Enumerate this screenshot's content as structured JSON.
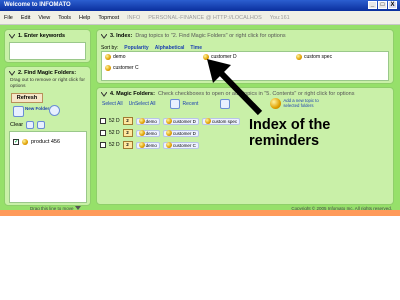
{
  "window": {
    "title": "Welcome to INFOMATO",
    "buttons": [
      "_",
      "□",
      "X"
    ]
  },
  "menu": {
    "items": [
      "File",
      "Edit",
      "View",
      "Tools",
      "Help",
      "Topmost"
    ],
    "grey_items": [
      "INFO",
      "PERSONAL-FINANCE @ HTTP://LOCALHOS",
      "You:161"
    ]
  },
  "panel1": {
    "title": "1. Enter keywords"
  },
  "panel2": {
    "title": "2. Find Magic Folders:",
    "hint": "Drag out to remove or right click for options",
    "refresh": "Refresh",
    "new_folder": "New Folder",
    "clear": "Clear",
    "folders": [
      {
        "label": "product 456",
        "checked": true
      }
    ]
  },
  "panel3": {
    "title": "3. Index:",
    "hint": "Drag topics to \"2. Find Magic Folders\" or right click for options",
    "sort_label": "Sort by:",
    "sort_options": [
      "Popularity",
      "Alphabetical",
      "Time"
    ],
    "items": [
      "demo",
      "customer D",
      "custom spec",
      "customer C"
    ]
  },
  "panel4": {
    "title": "4. Magic Folders:",
    "hint": "Check checkboxes to open or add topics in \"5. Contents\" or right click for options",
    "select_all": "Select All",
    "unselect_all": "UnSelect All",
    "recent": "Recent",
    "add_new": "Add a new topic to selected folders",
    "rows": [
      {
        "num": "52 D",
        "count": "2",
        "tags": [
          "demo",
          "customer D",
          "custom spec"
        ]
      },
      {
        "num": "52 D",
        "count": "2",
        "tags": [
          "demo",
          "customer D"
        ]
      },
      {
        "num": "52 D",
        "count": "2",
        "tags": [
          "demo",
          "customer C"
        ]
      }
    ]
  },
  "footer": {
    "drag": "Drag this line to move",
    "copyright": "Copyright © 2005 Infomato Inc. All rights reserved."
  },
  "annotation": "Index of the reminders"
}
